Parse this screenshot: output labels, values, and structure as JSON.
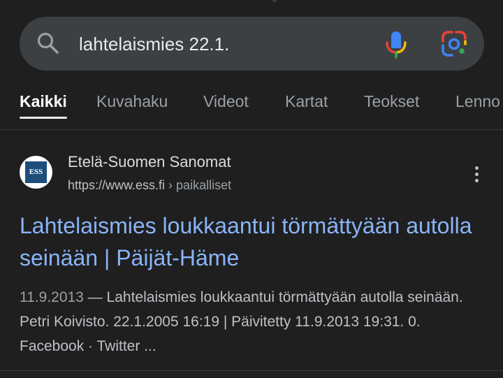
{
  "search": {
    "query": "lahtelaismies 22.1.",
    "icons": [
      "search-icon",
      "microphone-icon",
      "google-lens-icon"
    ]
  },
  "tabs": [
    {
      "label": "Kaikki",
      "active": true
    },
    {
      "label": "Kuvahaku",
      "active": false
    },
    {
      "label": "Videot",
      "active": false
    },
    {
      "label": "Kartat",
      "active": false
    },
    {
      "label": "Teokset",
      "active": false
    },
    {
      "label": "Lenno",
      "active": false
    }
  ],
  "result": {
    "favicon_text": "ESS",
    "site_name": "Etelä-Suomen Sanomat",
    "url": "https://www.ess.fi",
    "breadcrumb": " › paikalliset",
    "title": "Lahtelaismies loukkaantui törmättyään autolla seinään | Päijät-Häme",
    "snippet_date": "11.9.2013",
    "snippet_text": " — Lahtelaismies loukkaantui törmättyään autolla seinään. Petri Koivisto. 22.1.2005 16:19 | Päivitetty 11.9.2013 19:31. 0. Facebook · Twitter ..."
  },
  "colors": {
    "background": "#1f1f1f",
    "search_bar": "#3c4043",
    "link": "#8ab4f8",
    "favicon_bg": "#1d4e7c"
  }
}
